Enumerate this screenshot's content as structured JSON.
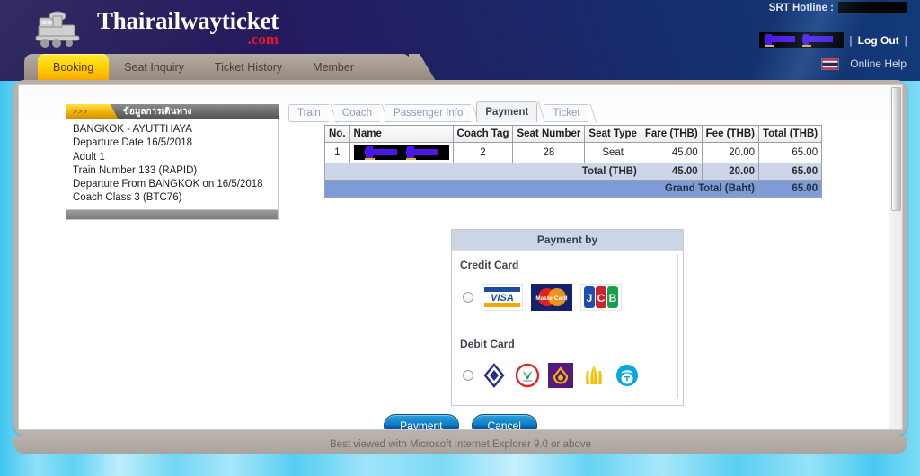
{
  "brand": {
    "name": "Thairailwayticket",
    "tld": ".com",
    "logo_icon": "steam-locomotive-icon"
  },
  "header": {
    "hotline_label": "SRT Hotline :",
    "hotline_value": "",
    "username_value": "",
    "logout_label": "Log Out",
    "separator": "|",
    "flag_icon": "thai-flag-icon",
    "online_help_label": "Online Help"
  },
  "nav": {
    "tabs": [
      {
        "label": "Booking",
        "active": true
      },
      {
        "label": "Seat Inquiry",
        "active": false
      },
      {
        "label": "Ticket History",
        "active": false
      },
      {
        "label": "Member",
        "active": false
      }
    ]
  },
  "travel_info": {
    "tab_marker": ">>>",
    "title": "ข้อมูลการเดินทาง",
    "lines": [
      "BANGKOK - AYUTTHAYA",
      "Departure Date 16/5/2018",
      "Adult 1",
      "Train Number 133 (RAPID)",
      "Departure From BANGKOK on 16/5/2018",
      "Coach Class 3 (BTC76)"
    ]
  },
  "steps": [
    {
      "label": "Train",
      "active": false
    },
    {
      "label": "Coach",
      "active": false
    },
    {
      "label": "Passenger Info",
      "active": false
    },
    {
      "label": "Payment",
      "active": true
    },
    {
      "label": "Ticket",
      "active": false
    }
  ],
  "booking_table": {
    "headers": [
      "No.",
      "Name",
      "Coach Tag",
      "Seat Number",
      "Seat Type",
      "Fare (THB)",
      "Fee (THB)",
      "Total (THB)"
    ],
    "rows": [
      {
        "no": "1",
        "name": "",
        "coach_tag": "2",
        "seat_number": "28",
        "seat_type": "Seat",
        "fare": "45.00",
        "fee": "20.00",
        "total": "65.00"
      }
    ],
    "total_row": {
      "label": "Total (THB)",
      "fare": "45.00",
      "fee": "20.00",
      "total": "65.00"
    },
    "grand_total_row": {
      "label": "Grand Total (Baht)",
      "value": "65.00"
    }
  },
  "payment": {
    "panel_title": "Payment by",
    "credit_card_label": "Credit Card",
    "credit_cards": [
      "visa-logo",
      "mastercard-logo",
      "jcb-logo"
    ],
    "debit_card_label": "Debit Card",
    "debit_banks": [
      "bangkok-bank-logo",
      "kasikorn-bank-logo",
      "siam-commercial-bank-logo",
      "krungsri-bank-logo",
      "krungthai-bank-logo"
    ],
    "credit_selected": false,
    "debit_selected": false
  },
  "actions": {
    "payment_label": "Payment",
    "cancel_label": "Cancel"
  },
  "footer": {
    "text": "Best viewed with Microsoft Internet Explorer 9.0 or above"
  },
  "colors": {
    "header_navy": "#1b1350",
    "active_tab_yellow": "#ffd400",
    "grand_total_blue": "#7d9bd4",
    "total_row_blue": "#ccd6e8",
    "panel_head_blue": "#ccd5e6",
    "button_blue": "#0c79c4",
    "brand_red": "#e8192c"
  }
}
